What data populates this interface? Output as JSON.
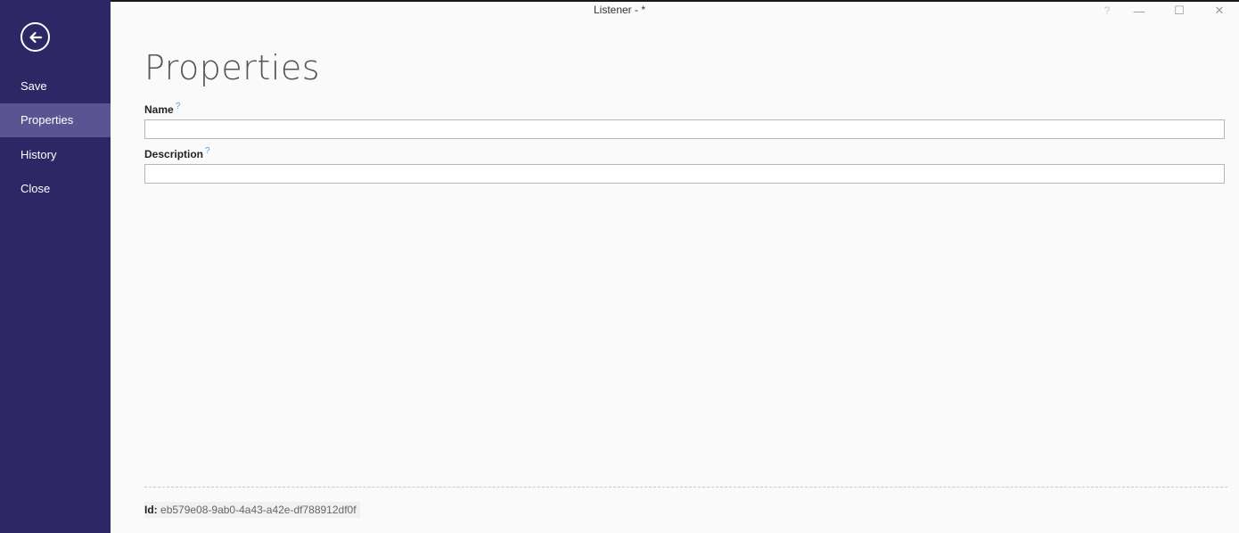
{
  "window": {
    "title": "Listener - *",
    "help_glyph": "?",
    "minimize_glyph": "—",
    "maximize_glyph": "☐",
    "close_glyph": "✕"
  },
  "sidebar": {
    "items": [
      {
        "label": "Save",
        "active": false
      },
      {
        "label": "Properties",
        "active": true
      },
      {
        "label": "History",
        "active": false
      },
      {
        "label": "Close",
        "active": false
      }
    ]
  },
  "main": {
    "title": "Properties",
    "fields": [
      {
        "label": "Name",
        "help": "?",
        "value": ""
      },
      {
        "label": "Description",
        "help": "?",
        "value": ""
      }
    ]
  },
  "footer": {
    "id_label": "Id:",
    "id_value": "eb579e08-9ab0-4a43-a42e-df788912df0f"
  },
  "colors": {
    "sidebar_bg": "#2e2766",
    "sidebar_active": "#5a5592",
    "help_accent": "#5b9bd5"
  }
}
